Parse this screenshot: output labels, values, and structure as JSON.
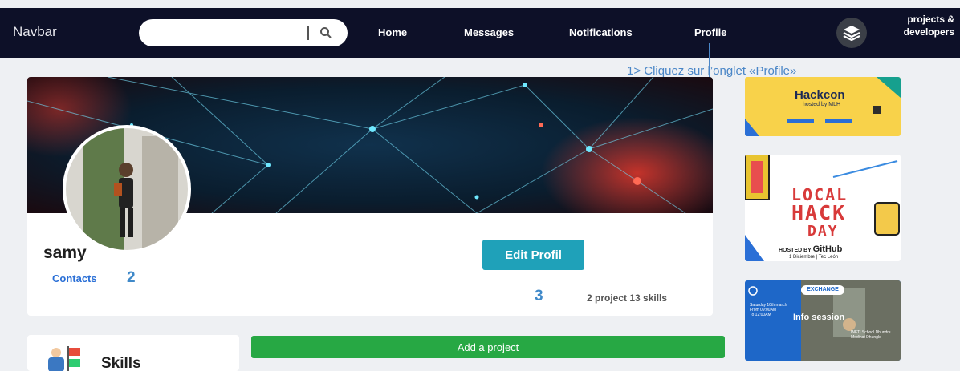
{
  "navbar": {
    "brand": "Navbar",
    "search": {
      "placeholder": ""
    },
    "links": [
      "Home",
      "Messages",
      "Notifications",
      "Profile"
    ],
    "brand_text_line1": "projects &",
    "brand_text_line2": "developers",
    "bg_color": "#0d1028"
  },
  "annotations": {
    "profile_tab": "1> Cliquez sur l’onglet «Profile»",
    "contacts_step": "2",
    "stats_step": "3"
  },
  "profile": {
    "name": "samy",
    "contacts_label": "Contacts",
    "edit_button": "Edit Profil",
    "stats": "2 project 13 skills"
  },
  "skills": {
    "title": "Skills"
  },
  "actions": {
    "add_project": "Add a project"
  },
  "sidebar": {
    "hackcon": {
      "title": "Hackcon",
      "subtitle": "hosted by MLH"
    },
    "local_hack_day": {
      "line1": "LOCAL",
      "line2": "HACK",
      "line3": "DAY",
      "hosted_by": "HOSTED BY",
      "host": "GitHub",
      "date": "1 Diciembre | Tec León"
    },
    "info_session": {
      "title": "Info session",
      "brand": "EXCHANGE",
      "date_line1": "Saturday 10th march",
      "date_line2": "From 09:00AM",
      "date_line3": "To 12:00AM",
      "location_line1": "INFTI School Dhundrs",
      "location_line2": "Medinat Dhungle"
    }
  },
  "colors": {
    "accent": "#1fa1b9",
    "green": "#27a844",
    "link": "#2a6fd6",
    "annotation": "#4a86c7"
  }
}
